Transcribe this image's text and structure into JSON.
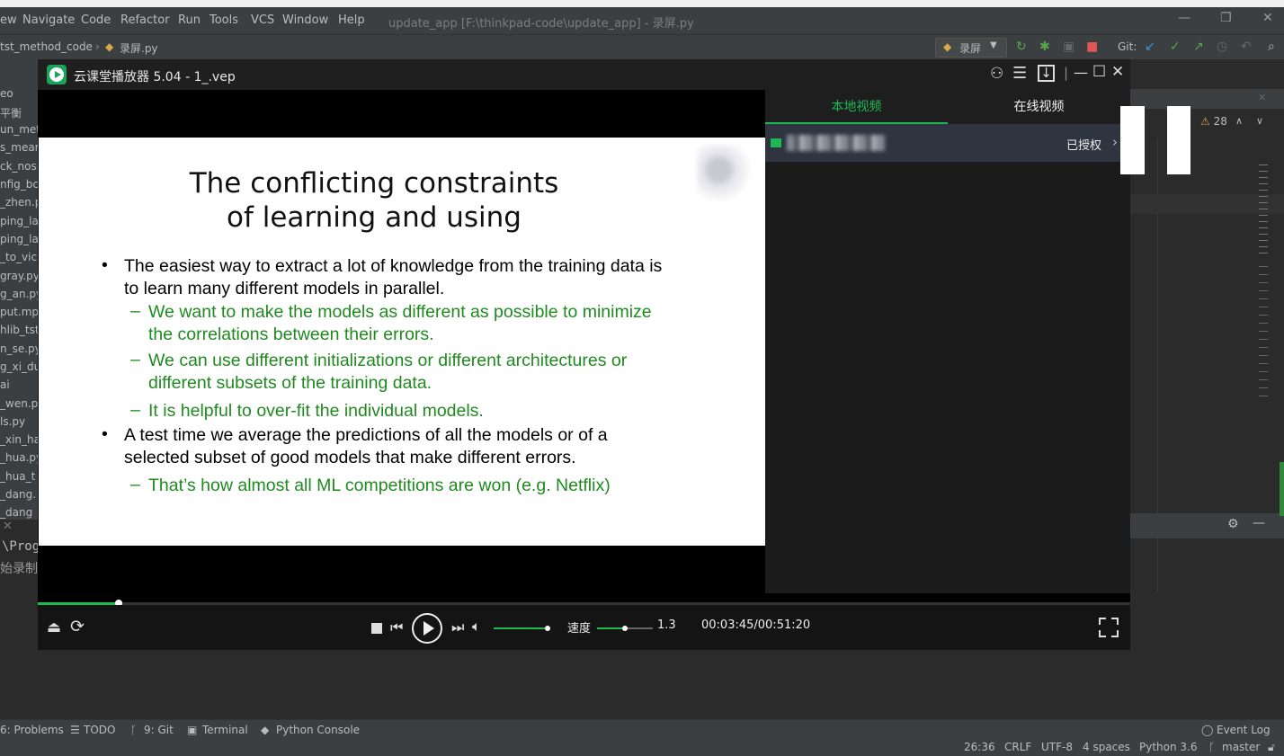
{
  "ide": {
    "menu": [
      "ew",
      "Navigate",
      "Code",
      "Refactor",
      "Run",
      "Tools",
      "VCS",
      "Window",
      "Help"
    ],
    "title": "update_app [F:\\thinkpad-code\\update_app] - 录屏.py",
    "breadcrumb_folder": "tst_method_code",
    "breadcrumb_file": "录屏.py",
    "run_config": "录屏",
    "git_label": "Git:",
    "warning_count": "28",
    "project_files": [
      "eo",
      "平衡",
      "un_met",
      "s_mear",
      "ck_nosi",
      "nfig_bck",
      "_zhen.p",
      "ping_la",
      "ping_la",
      "_to_vic",
      "gray.py",
      "g_an.py",
      "put.mp",
      "hlib_tst",
      "n_se.py",
      "g_xi_du",
      "ai",
      "_wen.p",
      "ls.py",
      "_xin_ha",
      "_hua.py",
      "_hua_t",
      "_dang.",
      "_dang"
    ],
    "console_lines": [
      "\\Prog",
      "始录制"
    ],
    "bottom_tabs": [
      "6: Problems",
      "TODO",
      "9: Git",
      "Terminal",
      "Python Console"
    ],
    "event_log": "Event Log",
    "status": {
      "position": "26:36",
      "line_sep": "CRLF",
      "encoding": "UTF-8",
      "indent": "4 spaces",
      "interpreter": "Python 3.6",
      "branch": "master"
    }
  },
  "player": {
    "title": "云课堂播放器 5.04 - 1_.vep",
    "tabs": {
      "local": "本地视频",
      "online": "在线视频"
    },
    "authorized": "已授权",
    "speed_label": "速度",
    "speed_value": "1.3",
    "time": "00:03:45/00:51:20",
    "progress": 0.073,
    "volume": 1.0,
    "speed_slider": 0.5
  },
  "slide": {
    "title_line1": "The conflicting constraints",
    "title_line2": "of learning and using",
    "b1_line1": "The easiest way to extract a lot of knowledge from the  training data is",
    "b1_line2": "to learn many different models in parallel.",
    "s1_line1": "We want to make the models as different as possible  to minimize",
    "s1_line2": "the correlations between their errors.",
    "s2_line1": "We can use different initializations or different  architectures or",
    "s2_line2": "different subsets of the training data.",
    "s3_line1": "It is helpful to over-fit the individual models.",
    "b2_line1": "A test time we average the predictions of all the models  or of a",
    "b2_line2": "selected subset of good models that make  different errors.",
    "s4_line1": "That’s how almost all ML competitions are won  (e.g. Netflix)"
  },
  "colors": {
    "accent_green": "#1db954",
    "slide_green": "#1f8a1f",
    "ide_bg": "#2b2b2b",
    "panel": "#3c3f41"
  }
}
